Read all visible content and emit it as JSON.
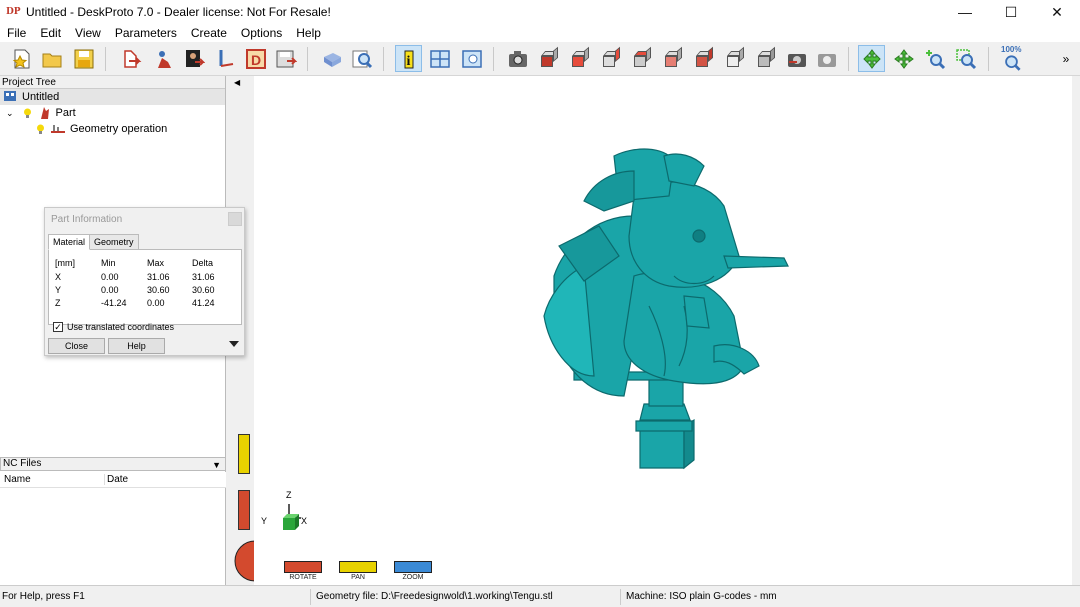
{
  "window": {
    "app_icon": "DP",
    "title": "Untitled - DeskProto 7.0 - Dealer license: Not For Resale!",
    "controls": [
      "—",
      "☐",
      "✕"
    ]
  },
  "menu": [
    "File",
    "Edit",
    "View",
    "Parameters",
    "Create",
    "Options",
    "Help"
  ],
  "toolbar": {
    "icons": [
      "new-file-icon",
      "open-folder-icon",
      "save-icon",
      "part-wizard-icon",
      "geometry-import-icon",
      "photo-icon",
      "vector-icon",
      "drawing-icon",
      "save-nc-icon",
      "camera-icon",
      "zoom-icon",
      "info-icon",
      "layout-icon",
      "view-window-icon",
      "screenshot-icon",
      "view-iso-icon",
      "view-front-icon",
      "view-right-icon",
      "view-back-icon",
      "view-left-icon",
      "view-top-icon",
      "view-bottom-icon",
      "cube-solid-icon",
      "rotate-view-icon",
      "camera2-icon",
      "rotate-mode-icon",
      "pan-mode-icon",
      "zoom-in-icon",
      "zoom-window-icon",
      "zoom-100-icon",
      "more-icon"
    ],
    "zoom_label": "100%",
    "more": "»"
  },
  "project_tree": {
    "header": "Project Tree",
    "root": "Untitled",
    "part": "Part",
    "operation": "Geometry operation"
  },
  "nc_files": {
    "header": "NC Files",
    "columns": [
      "Name",
      "Date"
    ]
  },
  "dialog": {
    "title": "Part Information",
    "tabs": [
      "Material",
      "Geometry"
    ],
    "headers": [
      "[mm]",
      "Min",
      "Max",
      "Delta"
    ],
    "rows": [
      [
        "X",
        "0.00",
        "31.06",
        "31.06"
      ],
      [
        "Y",
        "0.00",
        "30.60",
        "30.60"
      ],
      [
        "Z",
        "-41.24",
        "0.00",
        "41.24"
      ]
    ],
    "checkbox_label": "Use translated coordinates",
    "checkbox_checked": true,
    "close_label": "Close",
    "help_label": "Help"
  },
  "viewport": {
    "model_color": "#1aa5a8",
    "axes": {
      "z": "Z",
      "y": "Y",
      "x": "X"
    },
    "modes": [
      "ROTATE",
      "PAN",
      "ZOOM"
    ]
  },
  "status": {
    "help": "For Help, press F1",
    "geometry": "Geometry file: D:\\Freedesignwold\\1.working\\Tengu.stl",
    "machine": "Machine: ISO plain G-codes - mm"
  }
}
